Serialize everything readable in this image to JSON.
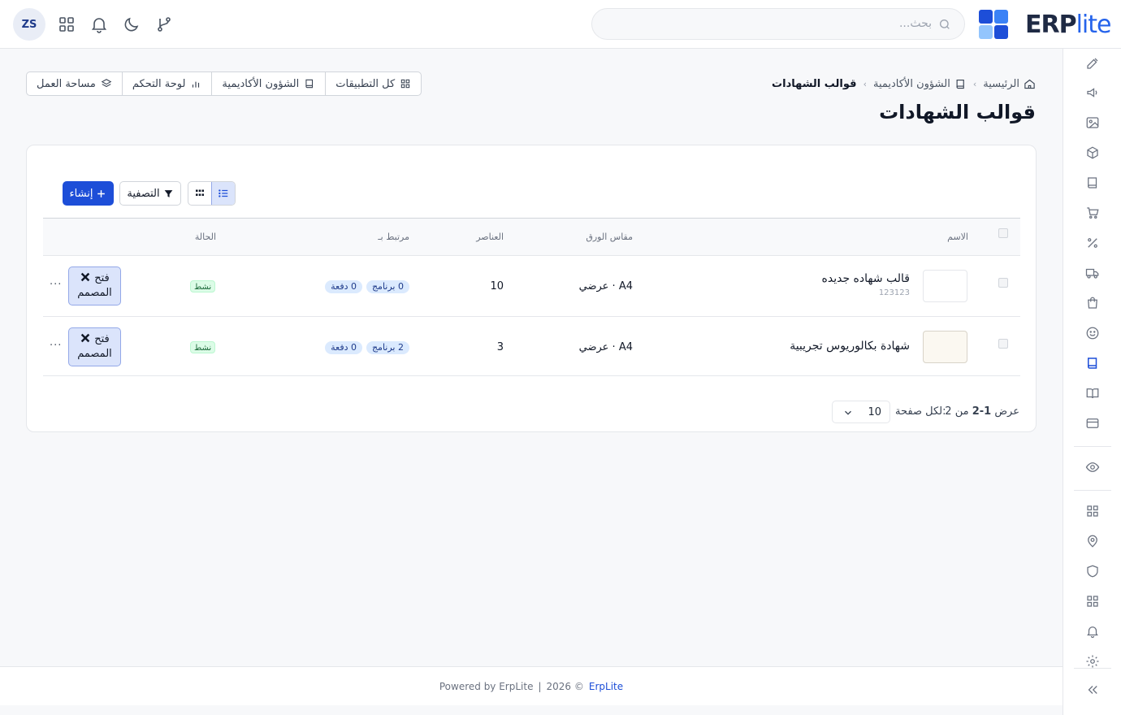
{
  "header": {
    "avatar_initials": "ZS",
    "search_placeholder": "بحث...",
    "logo_text_main": "ERP",
    "logo_text_suffix": "lite",
    "brand_colors": [
      "#1d4ed8",
      "#3b82f6",
      "#93c5fd"
    ]
  },
  "breadcrumb": {
    "home": "الرئيسية",
    "section": "الشؤون الأكاديمية",
    "current": "قوالب الشهادات"
  },
  "page": {
    "title": "قوالب الشهادات"
  },
  "quick_nav": [
    {
      "label": "كل التطبيقات",
      "icon": "grid-icon"
    },
    {
      "label": "الشؤون الأكاديمية",
      "icon": "book-icon"
    },
    {
      "label": "لوحة التحكم",
      "icon": "bar-chart-icon"
    },
    {
      "label": "مساحة العمل",
      "icon": "layers-icon"
    }
  ],
  "toolbar": {
    "create": "إنشاء",
    "filter": "التصفية"
  },
  "table": {
    "columns": {
      "name": "الاسم",
      "paper": "مقاس الورق",
      "elements": "العناصر",
      "linked": "مرتبط بـ",
      "status": "الحالة"
    },
    "rows": [
      {
        "name": "قالب شهاده جديده",
        "code": "123123",
        "paper": "A4 · عرضي",
        "elements": "10",
        "programs": "0 برنامج",
        "batches": "0 دفعة",
        "status": "نشط",
        "design_line1": "فتح",
        "design_line2": "المصمم",
        "more": "···"
      },
      {
        "name": "شهادة بكالوريوس تجريبية",
        "code": "",
        "paper": "A4 · عرضي",
        "elements": "3",
        "programs": "2 برنامج",
        "batches": "0 دفعة",
        "status": "نشط",
        "design_line1": "فتح",
        "design_line2": "المصمم",
        "more": "···"
      }
    ]
  },
  "pagination": {
    "showing_prefix": "عرض",
    "range": "1-2",
    "of": "من",
    "total": "2",
    "per_page_label": "لكل صفحة:",
    "per_page": "10"
  },
  "footer": {
    "powered": "Powered by ErpLite",
    "divider": "|",
    "copyright": "2026 ©",
    "brand_link": "ErpLite"
  }
}
